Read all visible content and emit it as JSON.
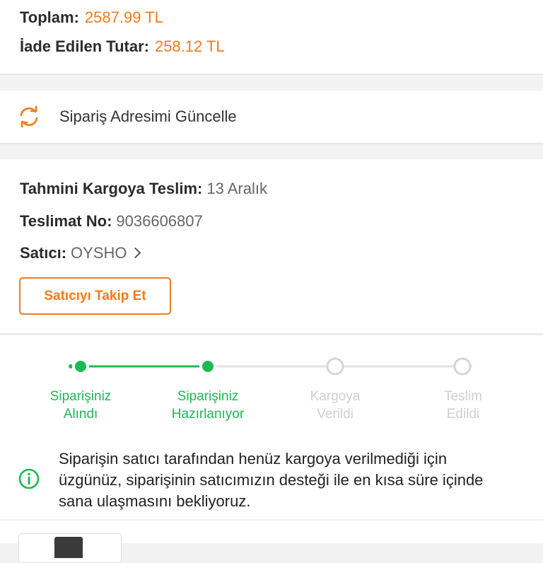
{
  "totals": {
    "total_label": "Toplam:",
    "total_value": "2587.99 TL",
    "refund_label": "İade Edilen Tutar:",
    "refund_value": "258.12 TL"
  },
  "address": {
    "icon": "refresh-icon",
    "label": "Sipariş Adresimi Güncelle"
  },
  "shipment": {
    "eta_label": "Tahmini Kargoya Teslim:",
    "eta_value": "13 Aralık",
    "delivery_no_label": "Teslimat No:",
    "delivery_no_value": "9036606807",
    "seller_label": "Satıcı:",
    "seller_value": "OYSHO",
    "follow_button": "Satıcıyı Takip Et"
  },
  "tracking": {
    "steps": [
      {
        "line1": "Siparişiniz",
        "line2": "Alındı",
        "done": true
      },
      {
        "line1": "Siparişiniz",
        "line2": "Hazırlanıyor",
        "done": true
      },
      {
        "line1": "Kargoya",
        "line2": "Verildi",
        "done": false
      },
      {
        "line1": "Teslim",
        "line2": "Edildi",
        "done": false
      }
    ],
    "message": "Siparişin satıcı tarafından henüz kargoya verilmediği için üzgünüz, siparişinin satıcımızın desteği ile en kısa süre içinde sana ulaşmasını bekliyoruz.",
    "message_icon": "info-icon"
  },
  "colors": {
    "accent": "#f27a1a",
    "success": "#1db954",
    "inactive": "#cfcfcf"
  }
}
